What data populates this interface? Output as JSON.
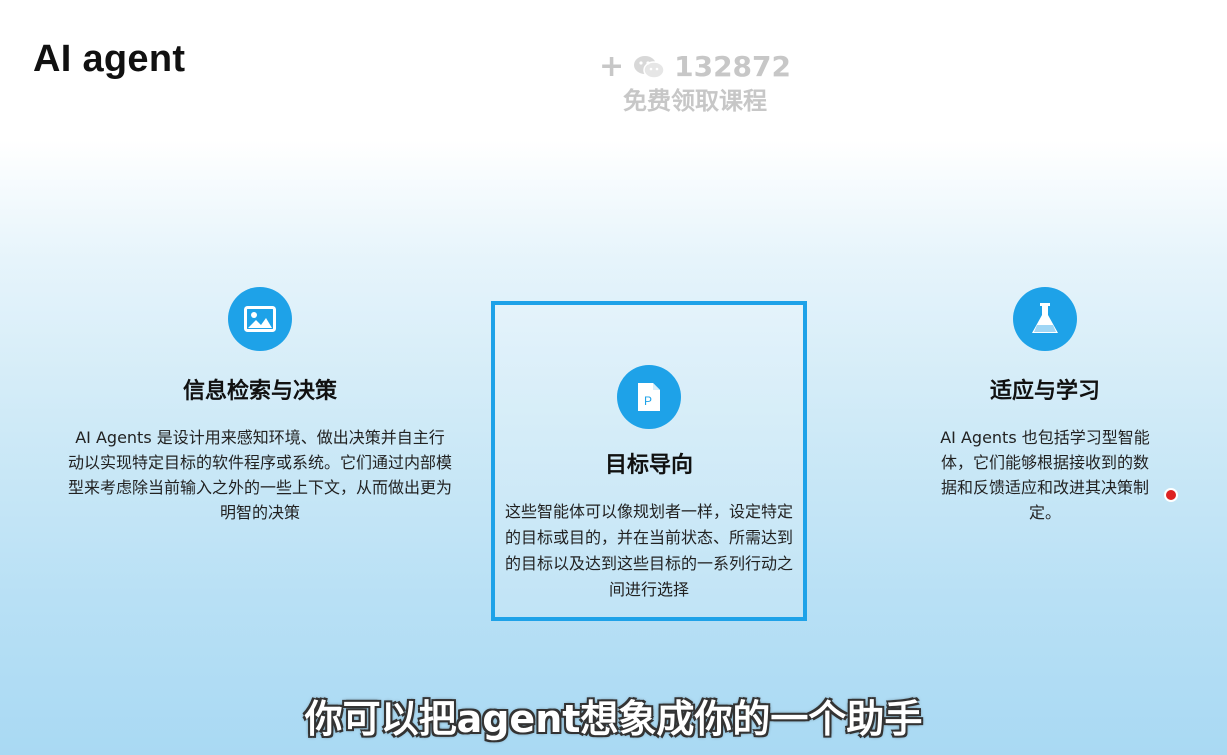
{
  "slide": {
    "title": "AI agent",
    "promo": {
      "plus": "+",
      "wechat_icon": "wechat-icon",
      "number": "132872",
      "text": "免费领取课程"
    },
    "features": [
      {
        "icon": "image-icon",
        "heading": "信息检索与决策",
        "body": "AI Agents 是设计用来感知环境、做出决策并自主行动以实现特定目标的软件程序或系统。它们通过内部模型来考虑除当前输入之外的一些上下文，从而做出更为明智的决策"
      },
      {
        "icon": "document-icon",
        "heading": "目标导向",
        "body": "这些智能体可以像规划者一样，设定特定的目标或目的，并在当前状态、所需达到的目标以及达到这些目标的一系列行动之间进行选择"
      },
      {
        "icon": "flask-icon",
        "heading": "适应与学习",
        "body": "AI Agents 也包括学习型智能体，它们能够根据接收到的数据和反馈适应和改进其决策制定。"
      }
    ]
  },
  "subtitle": "你可以把agent想象成你的一个助手",
  "colors": {
    "accent": "#1ea2e8",
    "title": "#111111",
    "promo": "#c7c7c7"
  }
}
